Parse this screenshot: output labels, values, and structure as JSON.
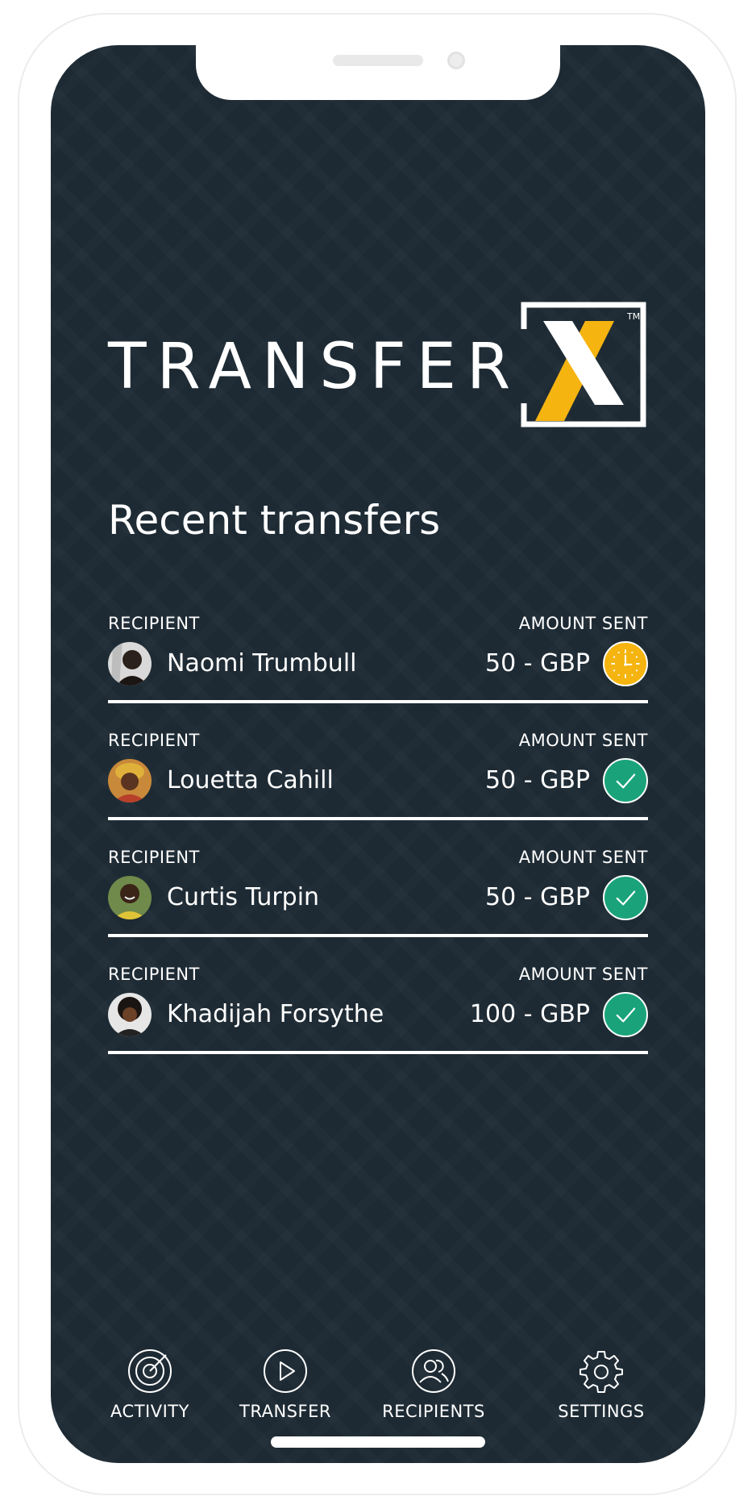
{
  "app": {
    "brand_text": "TRANSFER",
    "brand_mark": "X",
    "brand_tm": "TM",
    "accent_color": "#f5b40f",
    "success_color": "#1aa37a",
    "background_color": "#1d2a33"
  },
  "main": {
    "title": "Recent transfers",
    "transfers": [
      {
        "recipient_label": "RECIPIENT",
        "amount_label": "AMOUNT SENT",
        "name": "Naomi Trumbull",
        "amount": "50 - GBP",
        "status": "pending",
        "status_icon": "clock-icon"
      },
      {
        "recipient_label": "RECIPIENT",
        "amount_label": "AMOUNT SENT",
        "name": "Louetta Cahill",
        "amount": "50 - GBP",
        "status": "completed",
        "status_icon": "check-icon"
      },
      {
        "recipient_label": "RECIPIENT",
        "amount_label": "AMOUNT SENT",
        "name": "Curtis Turpin",
        "amount": "50 - GBP",
        "status": "completed",
        "status_icon": "check-icon"
      },
      {
        "recipient_label": "RECIPIENT",
        "amount_label": "AMOUNT SENT",
        "name": "Khadijah Forsythe",
        "amount": "100 - GBP",
        "status": "completed",
        "status_icon": "check-icon"
      }
    ]
  },
  "nav": {
    "items": [
      {
        "label": "ACTIVITY",
        "icon": "radar-icon"
      },
      {
        "label": "TRANSFER",
        "icon": "play-icon"
      },
      {
        "label": "RECIPIENTS",
        "icon": "people-icon"
      },
      {
        "label": "SETTINGS",
        "icon": "gear-icon"
      }
    ]
  }
}
